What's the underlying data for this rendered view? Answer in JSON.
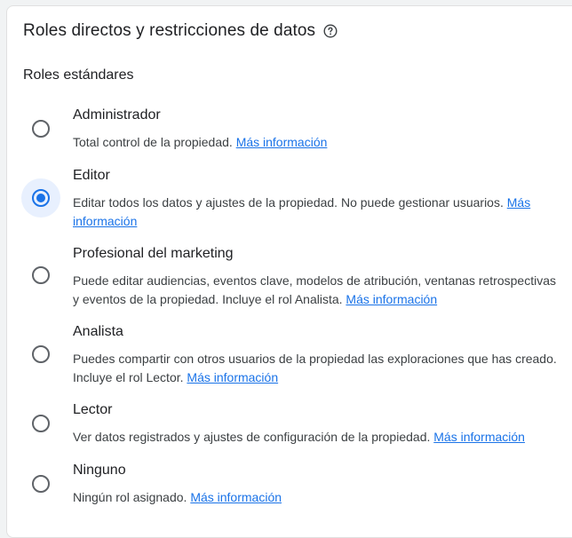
{
  "header": {
    "title": "Roles directos y restricciones de datos",
    "help_icon": "help-circle-icon"
  },
  "section": {
    "title": "Roles estándares"
  },
  "colors": {
    "accent": "#1a73e8",
    "selected_bg": "#e8f0fe",
    "text": "#202124"
  },
  "roles": [
    {
      "name": "Administrador",
      "description": "Total control de la propiedad.",
      "link": "Más información",
      "selected": false
    },
    {
      "name": "Editor",
      "description": "Editar todos los datos y ajustes de la propiedad. No puede gestionar usuarios.",
      "link": "Más información",
      "selected": true
    },
    {
      "name": "Profesional del marketing",
      "description": "Puede editar audiencias, eventos clave, modelos de atribución, ventanas retrospectivas y eventos de la propiedad. Incluye el rol Analista.",
      "link": "Más información",
      "selected": false
    },
    {
      "name": "Analista",
      "description": "Puedes compartir con otros usuarios de la propiedad las exploraciones que has creado. Incluye el rol Lector.",
      "link": "Más información",
      "selected": false
    },
    {
      "name": "Lector",
      "description": "Ver datos registrados y ajustes de configuración de la propiedad.",
      "link": "Más información",
      "selected": false
    },
    {
      "name": "Ninguno",
      "description": "Ningún rol asignado.",
      "link": "Más información",
      "selected": false
    }
  ]
}
